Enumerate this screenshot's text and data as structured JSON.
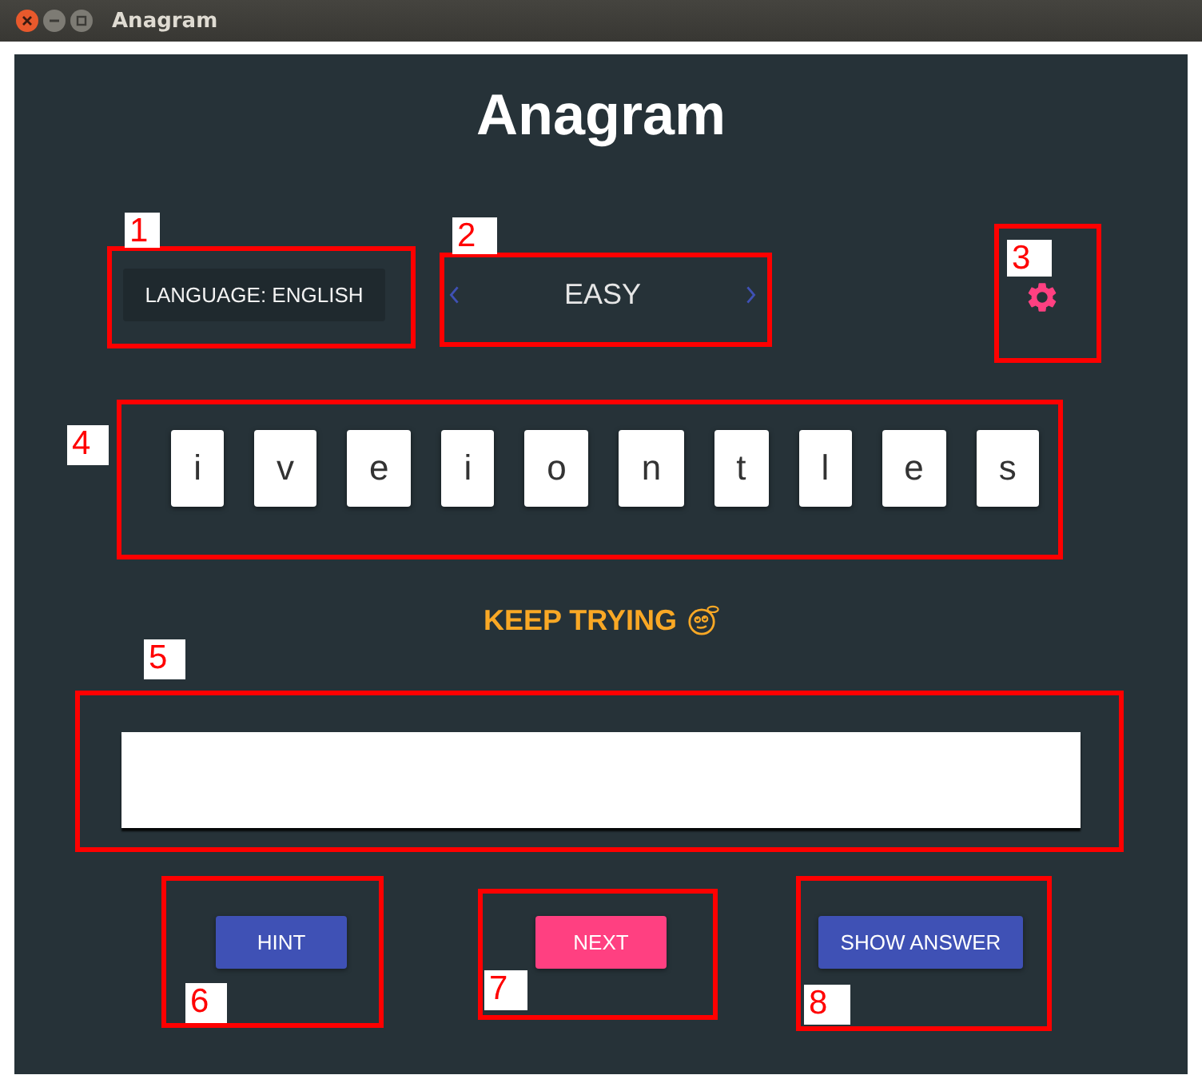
{
  "window": {
    "title": "Anagram"
  },
  "header": {
    "title": "Anagram"
  },
  "controls": {
    "language_button": "LANGUAGE: ENGLISH",
    "difficulty": "EASY"
  },
  "letters": [
    "i",
    "v",
    "e",
    "i",
    "o",
    "n",
    "t",
    "l",
    "e",
    "s"
  ],
  "feedback": "KEEP TRYING",
  "buttons": [
    {
      "label": "HINT",
      "kind": "primary"
    },
    {
      "label": "NEXT",
      "kind": "accent"
    },
    {
      "label": "SHOW ANSWER",
      "kind": "primary"
    }
  ],
  "annotations": [
    {
      "number": "1"
    },
    {
      "number": "2"
    },
    {
      "number": "3"
    },
    {
      "number": "4"
    },
    {
      "number": "5"
    },
    {
      "number": "6"
    },
    {
      "number": "7"
    },
    {
      "number": "8"
    }
  ]
}
